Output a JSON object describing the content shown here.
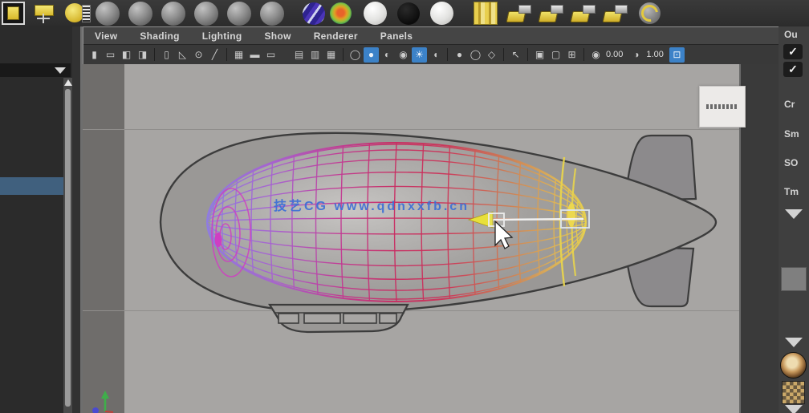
{
  "shelf": {
    "items": [
      {
        "name": "render-view-icon",
        "type": "yellow-square"
      },
      {
        "name": "area-light-icon",
        "type": "yellow-rect"
      },
      {
        "name": "volume-light-icon",
        "type": "yellow-circle"
      },
      {
        "name": "standard-material-sphere-1",
        "type": "gray-ball"
      },
      {
        "name": "standard-material-sphere-2",
        "type": "gray-ball"
      },
      {
        "name": "standard-material-sphere-3",
        "type": "gray-ball"
      },
      {
        "name": "standard-material-sphere-4",
        "type": "gray-ball"
      },
      {
        "name": "standard-material-sphere-5",
        "type": "gray-ball"
      },
      {
        "name": "standard-material-sphere-6",
        "type": "gray-ball"
      },
      {
        "name": "layered-shader-icon",
        "type": "purple-ball"
      },
      {
        "name": "ramp-shader-icon",
        "type": "rainbow-ball"
      },
      {
        "name": "white-material-sphere-icon",
        "type": "white-ball"
      },
      {
        "name": "black-material-sphere-icon",
        "type": "black-ball"
      },
      {
        "name": "blinn-material-sphere-icon",
        "type": "white-ball"
      },
      {
        "name": "texture-swatch-icon",
        "type": "yellow-texture"
      },
      {
        "name": "spot-light-icon-1",
        "type": "spotlight"
      },
      {
        "name": "spot-light-icon-2",
        "type": "spotlight"
      },
      {
        "name": "spot-light-icon-3",
        "type": "spotlight"
      },
      {
        "name": "spot-light-icon-4",
        "type": "spotlight"
      },
      {
        "name": "ambient-light-icon",
        "type": "ring-ball"
      }
    ]
  },
  "panel_menu": {
    "items": [
      "View",
      "Shading",
      "Lighting",
      "Show",
      "Renderer",
      "Panels"
    ]
  },
  "toolbar": {
    "exposure_value": "0.00",
    "gamma_value": "1.00",
    "icons": [
      {
        "name": "panel-grip-icon",
        "glyph": "▮",
        "active": false
      },
      {
        "name": "select-camera-icon",
        "glyph": "▭",
        "active": false
      },
      {
        "name": "lock-camera-icon",
        "glyph": "◧",
        "active": false
      },
      {
        "name": "camera-attributes-icon",
        "glyph": "◨",
        "active": false
      },
      {
        "name": "sep"
      },
      {
        "name": "bookmark-icon",
        "glyph": "▯",
        "active": false
      },
      {
        "name": "protractor-icon",
        "glyph": "◺",
        "active": false
      },
      {
        "name": "joint-tool-icon",
        "glyph": "⊙",
        "active": false
      },
      {
        "name": "pencil-line-icon",
        "glyph": "╱",
        "active": false
      },
      {
        "name": "sep"
      },
      {
        "name": "film-gate-icon",
        "glyph": "▦",
        "active": false
      },
      {
        "name": "resolution-gate-icon",
        "glyph": "▬",
        "active": false
      },
      {
        "name": "gate-mask-icon",
        "glyph": "▭",
        "active": false
      },
      {
        "name": "gap"
      },
      {
        "name": "field-chart-icon",
        "glyph": "▤",
        "active": false
      },
      {
        "name": "safe-action-icon",
        "glyph": "▥",
        "active": false
      },
      {
        "name": "safe-title-icon",
        "glyph": "▦",
        "active": false
      },
      {
        "name": "sep"
      },
      {
        "name": "wireframe-display-icon",
        "glyph": "◯",
        "active": false
      },
      {
        "name": "shaded-display-icon",
        "glyph": "●",
        "active": true
      },
      {
        "name": "textured-display-icon",
        "glyph": "◐",
        "active": false
      },
      {
        "name": "material-globe-icon",
        "glyph": "◉",
        "active": false
      },
      {
        "name": "use-all-lights-icon",
        "glyph": "☀",
        "active": true
      },
      {
        "name": "shadows-icon",
        "glyph": "◖",
        "active": false
      },
      {
        "name": "sep"
      },
      {
        "name": "sphere-shaded-icon",
        "glyph": "●",
        "active": false
      },
      {
        "name": "sphere-outline-icon",
        "glyph": "◯",
        "active": false
      },
      {
        "name": "diamond-icon",
        "glyph": "◇",
        "active": false
      },
      {
        "name": "sep"
      },
      {
        "name": "select-tool-icon",
        "glyph": "↖",
        "active": false
      },
      {
        "name": "sep"
      },
      {
        "name": "image-plane-icon",
        "glyph": "▣",
        "active": false
      },
      {
        "name": "image-plane-front-icon",
        "glyph": "▢",
        "active": false
      },
      {
        "name": "image-plane-split-icon",
        "glyph": "⊞",
        "active": false
      },
      {
        "name": "sep"
      },
      {
        "name": "exposure-icon",
        "glyph": "◉",
        "active": false
      },
      {
        "name": "val:exposure_value"
      },
      {
        "name": "gamma-icon",
        "glyph": "◑",
        "active": false
      },
      {
        "name": "val:gamma_value"
      },
      {
        "name": "fx-icon",
        "glyph": "⊡",
        "active": true
      }
    ]
  },
  "right_panel": {
    "title": "Ou",
    "check_glyph": "✓",
    "rows": [
      "Cr",
      "Sm",
      "SO",
      "Tm"
    ]
  },
  "viewport": {
    "watermark": "技艺CG  www.qdnxxfb.cn",
    "colors": {
      "background": "#a7a5a3",
      "left_band": "#6f6d6b",
      "body_fill": "#9a9896",
      "body_outline": "#3c3c3c",
      "fin_fill": "#8c8a8c",
      "mesh_gradient": [
        "#8f7ce0",
        "#a85fd0",
        "#c23a96",
        "#c92a62",
        "#cc3358",
        "#cf7a52",
        "#ddb055",
        "#e8d44c"
      ],
      "pole_scribble": "#cf3ec2",
      "highlight_yellow": "#e8d44c",
      "manipulator_yellow": "#e8e03a",
      "watermark_blue": "#3d6fd6",
      "selection_box": "#dde6ee"
    }
  }
}
